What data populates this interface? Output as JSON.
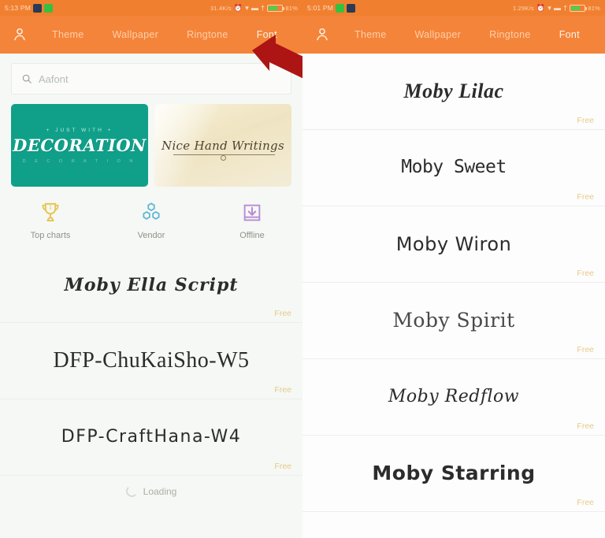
{
  "app": {
    "accent_orange": "#f4843a",
    "status_orange": "#f08030",
    "free_gold": "#e8c98a",
    "teal_card": "#10a08a",
    "annotation_red": "#b01818"
  },
  "left": {
    "statusbar": {
      "clock": "5:13 PM",
      "data_rate": "31.4K/s",
      "battery_pct": "81%",
      "icons": [
        "alarm-icon",
        "wifi-icon",
        "signal-icon",
        "bluetooth-icon",
        "battery-icon"
      ]
    },
    "nav": {
      "avatar_icon": "person-icon",
      "tabs": [
        {
          "label": "Theme",
          "active": false
        },
        {
          "label": "Wallpaper",
          "active": false
        },
        {
          "label": "Ringtone",
          "active": false
        },
        {
          "label": "Font",
          "active": true
        }
      ]
    },
    "search": {
      "icon": "search-icon",
      "placeholder": "Aafont",
      "value": ""
    },
    "banners": [
      {
        "name": "decoration-banner",
        "kicker": "+ JUST WITH +",
        "title": "DECORATION",
        "subtitle": "D E C O R A T I O N"
      },
      {
        "name": "handwriting-banner",
        "title": "Nice Hand Writings"
      }
    ],
    "quick_actions": [
      {
        "label": "Top charts",
        "icon": "trophy-icon"
      },
      {
        "label": "Vendor",
        "icon": "hexagon-cluster-icon"
      },
      {
        "label": "Offline",
        "icon": "download-tray-icon"
      }
    ],
    "fonts": [
      {
        "name": "Moby Ella Script",
        "price": "Free",
        "style": "f-script"
      },
      {
        "name": "DFP-ChuKaiSho-W5",
        "price": "Free",
        "style": "f-serif"
      },
      {
        "name": "DFP-CraftHana-W4",
        "price": "Free",
        "style": "f-craft"
      }
    ],
    "loading_label": "Loading"
  },
  "right": {
    "statusbar": {
      "clock": "5:01 PM",
      "data_rate": "1.29K/s",
      "battery_pct": "81%",
      "icons": [
        "alarm-icon",
        "wifi-icon",
        "signal-icon",
        "bluetooth-icon",
        "battery-icon"
      ]
    },
    "nav": {
      "avatar_icon": "person-icon",
      "tabs": [
        {
          "label": "Theme",
          "active": false
        },
        {
          "label": "Wallpaper",
          "active": false
        },
        {
          "label": "Ringtone",
          "active": false
        },
        {
          "label": "Font",
          "active": true
        }
      ]
    },
    "fonts": [
      {
        "name": "Moby Lilac",
        "price": "Free",
        "style": "f-lilac"
      },
      {
        "name": "Moby Sweet",
        "price": "Free",
        "style": "f-sweet"
      },
      {
        "name": "Moby Wiron",
        "price": "Free",
        "style": "f-wiron"
      },
      {
        "name": "Moby Spirit",
        "price": "Free",
        "style": "f-spirit"
      },
      {
        "name": "Moby Redflow",
        "price": "Free",
        "style": "f-redflow"
      },
      {
        "name": "Moby Starring",
        "price": "Free",
        "style": "f-starring"
      }
    ]
  },
  "annotation": {
    "name": "red-arrow-pointing-to-font-tab"
  }
}
